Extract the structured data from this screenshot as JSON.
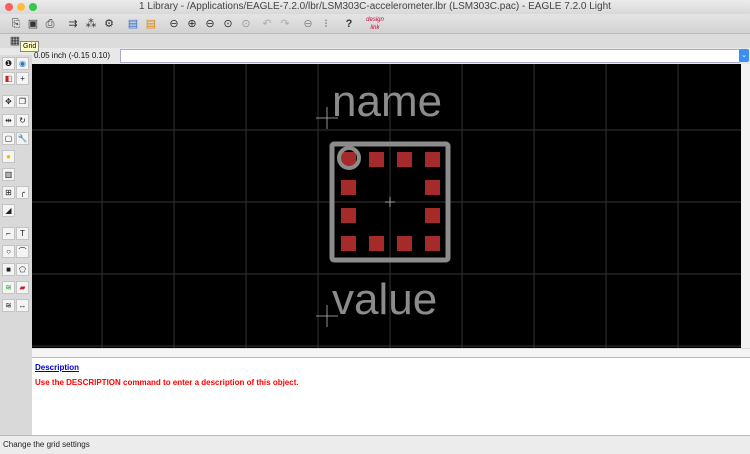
{
  "window": {
    "title": "1 Library - /Applications/EAGLE-7.2.0/lbr/LSM303C-accelerometer.lbr (LSM303C.pac) - EAGLE 7.2.0 Light"
  },
  "toolbar": {
    "icons": [
      "open-icon",
      "save-icon",
      "print-icon",
      "use-icon",
      "script-icon",
      "run-icon",
      "board-icon",
      "schematic-icon",
      "zoom-fit-icon",
      "zoom-in-icon",
      "zoom-out-icon",
      "zoom-select-icon",
      "zoom-last-icon",
      "undo-icon",
      "redo-icon",
      "stop-icon",
      "go-icon",
      "help-icon",
      "designlink-icon"
    ],
    "designlink_label": "design link"
  },
  "grid_toolbar": {
    "icon": "grid-icon",
    "tooltip": "Grid"
  },
  "coordinate": "0.05 inch (-0.15 0.10)",
  "command_input": {
    "value": ""
  },
  "sidebar": {
    "tools": [
      "info",
      "show",
      "display",
      "mark",
      "move",
      "copy",
      "mirror",
      "rotate",
      "group",
      "change",
      "paste",
      "delete",
      "smash",
      "miter",
      "split",
      "wire",
      "text",
      "circle",
      "arc",
      "rect",
      "polygon",
      "smd",
      "pad",
      "via",
      "dimension"
    ]
  },
  "canvas": {
    "name_label": "name",
    "value_label": "value",
    "pad_color": "#a52a2a",
    "outline_color": "#8c8c8c",
    "grid_color": "#333333"
  },
  "description": {
    "title": "Description",
    "text": "Use the DESCRIPTION command to enter a description of this object."
  },
  "status": "Change the grid settings"
}
